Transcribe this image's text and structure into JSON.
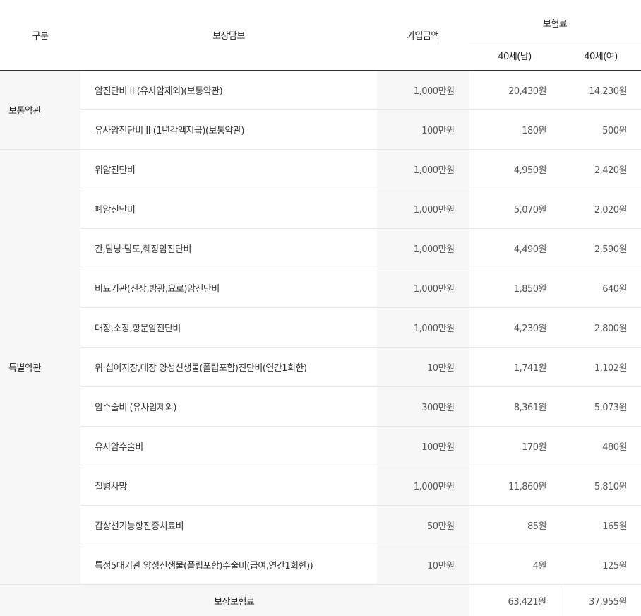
{
  "header": {
    "category": "구분",
    "coverage": "보장담보",
    "amount": "가입금액",
    "premium": "보험료",
    "male": "40세(남)",
    "female": "40세(여)"
  },
  "groups": [
    {
      "label": "보통약관",
      "rows": [
        {
          "name": "암진단비 II (유사암제외)(보통약관)",
          "amount": "1,000만원",
          "male": "20,430원",
          "female": "14,230원"
        },
        {
          "name": "유사암진단비 II (1년감액지급)(보통약관)",
          "amount": "100만원",
          "male": "180원",
          "female": "500원"
        }
      ]
    },
    {
      "label": "특별약관",
      "rows": [
        {
          "name": "위암진단비",
          "amount": "1,000만원",
          "male": "4,950원",
          "female": "2,420원"
        },
        {
          "name": "폐암진단비",
          "amount": "1,000만원",
          "male": "5,070원",
          "female": "2,020원"
        },
        {
          "name": "간,담낭·담도,췌장암진단비",
          "amount": "1,000만원",
          "male": "4,490원",
          "female": "2,590원"
        },
        {
          "name": "비뇨기관(신장,방광,요로)암진단비",
          "amount": "1,000만원",
          "male": "1,850원",
          "female": "640원"
        },
        {
          "name": "대장,소장,항문암진단비",
          "amount": "1,000만원",
          "male": "4,230원",
          "female": "2,800원"
        },
        {
          "name": "위·십이지장,대장 양성신생물(폴립포함)진단비(연간1회한)",
          "amount": "10만원",
          "male": "1,741원",
          "female": "1,102원"
        },
        {
          "name": "암수술비 (유사암제외)",
          "amount": "300만원",
          "male": "8,361원",
          "female": "5,073원"
        },
        {
          "name": "유사암수술비",
          "amount": "100만원",
          "male": "170원",
          "female": "480원"
        },
        {
          "name": "질병사망",
          "amount": "1,000만원",
          "male": "11,860원",
          "female": "5,810원"
        },
        {
          "name": "갑상선기능항진증치료비",
          "amount": "50만원",
          "male": "85원",
          "female": "165원"
        },
        {
          "name": "특정5대기관 양성신생물(폴립포함)수술비(급여,연간1회한))",
          "amount": "10만원",
          "male": "4원",
          "female": "125원"
        }
      ]
    }
  ],
  "total": {
    "label": "보장보험료",
    "male": "63,421원",
    "female": "37,955원"
  }
}
